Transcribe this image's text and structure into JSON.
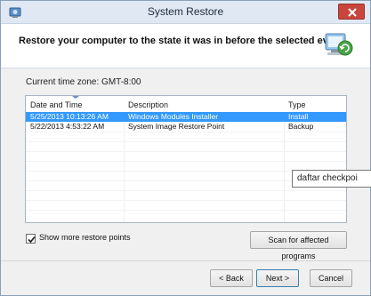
{
  "window": {
    "title": "System Restore"
  },
  "header": {
    "text": "Restore your computer to the state it was in before the selected event"
  },
  "timezone": "Current time zone: GMT-8:00",
  "table": {
    "columns": [
      "Date and Time",
      "Description",
      "Type"
    ],
    "rows": [
      {
        "date": "5/25/2013 10:13:26 AM",
        "description": "Windows Modules Installer",
        "type": "Install",
        "selected": true
      },
      {
        "date": "5/22/2013 4:53:22 AM",
        "description": "System Image Restore Point",
        "type": "Backup",
        "selected": false
      }
    ]
  },
  "show_more": {
    "label": "Show more restore points",
    "checked": true
  },
  "buttons": {
    "scan": "Scan for affected programs",
    "back": "< Back",
    "next": "Next >",
    "cancel": "Cancel"
  },
  "tooltip": "daftar checkpoi",
  "colors": {
    "selection": "#3399ff",
    "close_button": "#c9463d"
  }
}
